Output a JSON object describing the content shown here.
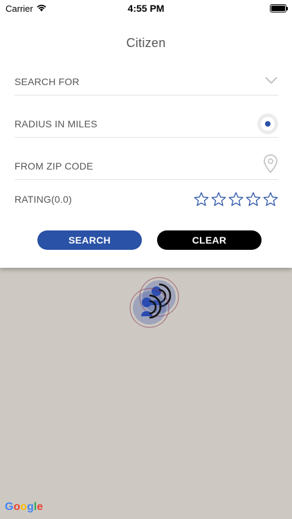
{
  "status": {
    "carrier": "Carrier",
    "time": "4:55 PM"
  },
  "page": {
    "title": "Citizen"
  },
  "form": {
    "search_for_label": "SEARCH FOR",
    "radius_label": "RADIUS IN MILES",
    "zip_label": "FROM ZIP CODE",
    "rating_label": "RATING(0.0)",
    "rating_value": 0,
    "rating_max": 5
  },
  "buttons": {
    "search_label": "SEARCH",
    "clear_label": "CLEAR"
  },
  "map": {
    "attribution": "Google"
  },
  "colors": {
    "accent": "#2a52a6",
    "star_outline": "#2a52a6",
    "clear_button": "#000000",
    "map_background": "#cdc9c2"
  },
  "icons": {
    "wifi": "wifi-icon",
    "battery": "battery-icon",
    "dropdown": "chevron-down-icon",
    "radius": "radio-icon",
    "zip": "location-pin-icon",
    "star": "star-outline-icon",
    "marker": "map-marker-icon"
  }
}
